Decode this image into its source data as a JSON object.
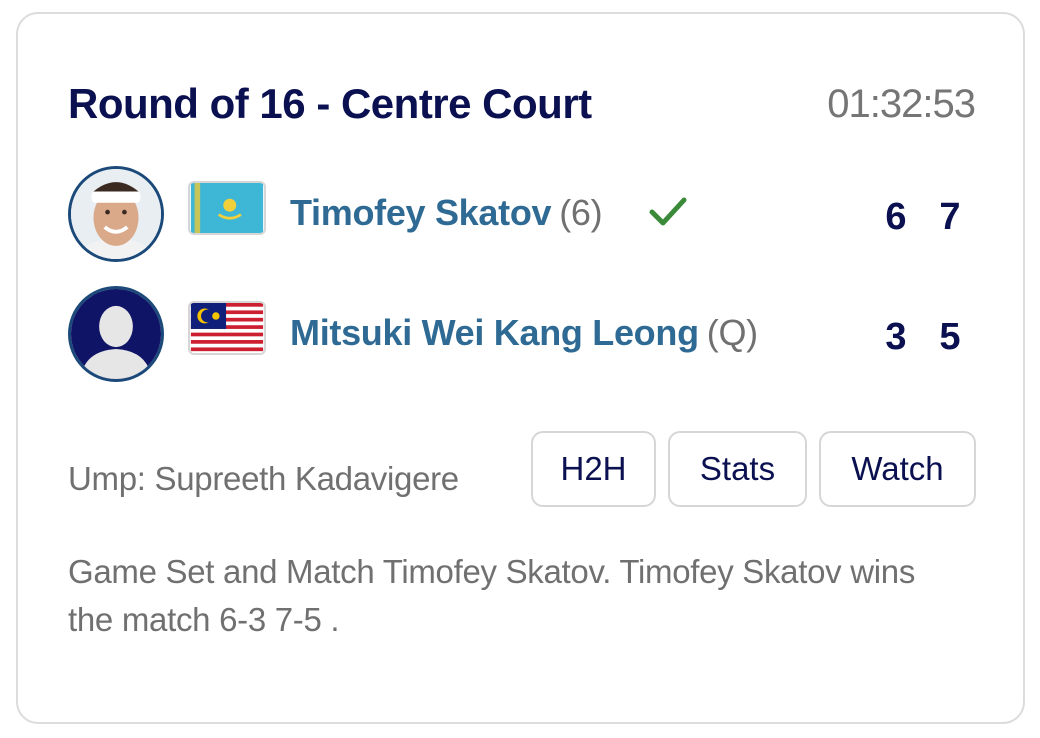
{
  "match": {
    "title": "Round of 16 - Centre Court",
    "duration": "01:32:53",
    "umpire": "Ump: Supreeth Kadavigere",
    "summary": "Game Set and Match Timofey Skatov. Timofey Skatov wins the match 6-3 7-5 ."
  },
  "players": [
    {
      "name": "Timofey Skatov",
      "seed": "(6)",
      "country_flag": "kazakhstan-flag",
      "winner": true,
      "sets": [
        "6",
        "7"
      ]
    },
    {
      "name": "Mitsuki Wei Kang Leong",
      "seed": "(Q)",
      "country_flag": "malaysia-flag",
      "winner": false,
      "sets": [
        "3",
        "5"
      ]
    }
  ],
  "actions": {
    "h2h_label": "H2H",
    "stats_label": "Stats",
    "watch_label": "Watch"
  },
  "colors": {
    "title": "#0a1050",
    "player_name": "#2e6a93",
    "muted": "#707070",
    "winner_check": "#3a8a3a",
    "avatar_border": "#1b4a7a"
  }
}
